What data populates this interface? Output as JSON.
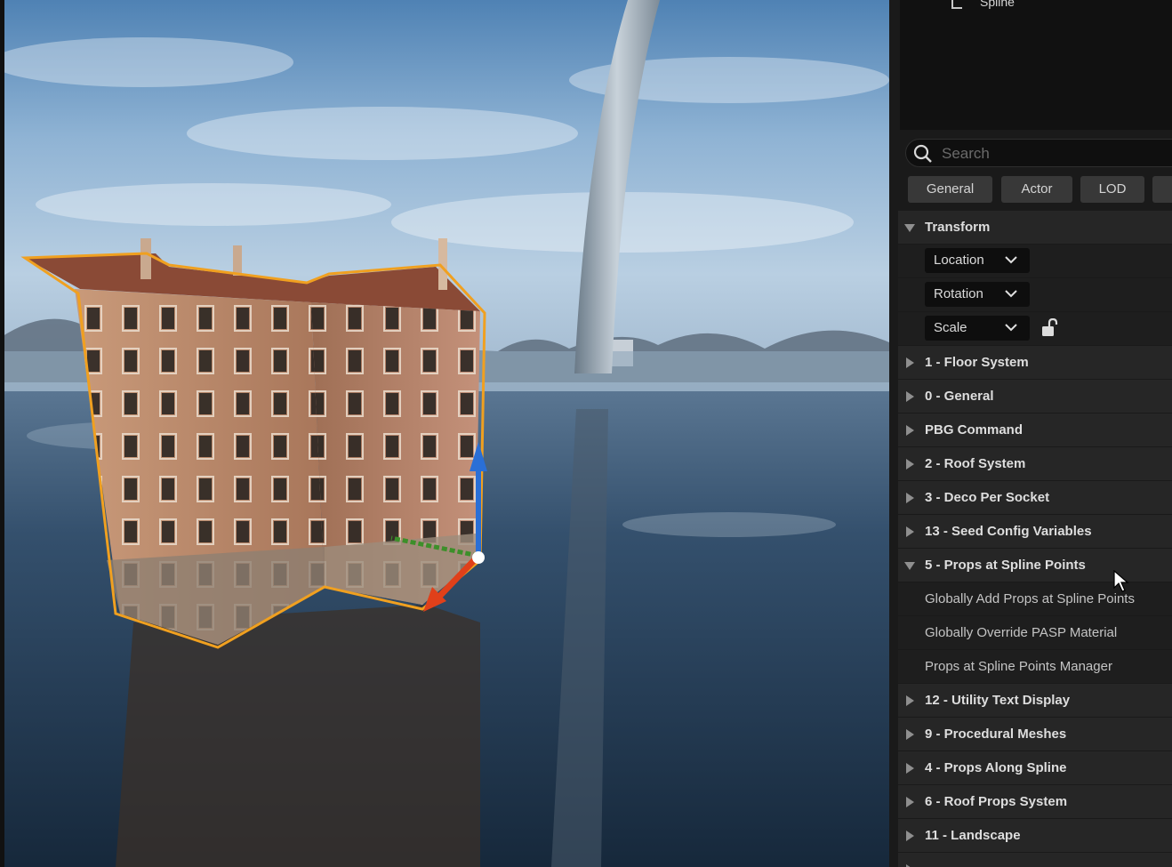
{
  "outliner": {
    "item_label": "Spline"
  },
  "search": {
    "placeholder": "Search"
  },
  "filter_tabs": [
    "General",
    "Actor",
    "LOD"
  ],
  "transform": {
    "header": "Transform",
    "dropdowns": [
      "Location",
      "Rotation",
      "Scale"
    ]
  },
  "categories": [
    "1 - Floor System",
    "0 - General",
    "PBG Command",
    "2 - Roof System",
    "3 - Deco Per Socket",
    "13 - Seed Config Variables",
    "5 - Props at Spline Points"
  ],
  "expanded_items": [
    "Globally Add Props at Spline Points",
    "Globally Override PASP Material",
    "Props at Spline Points Manager"
  ],
  "more_categories": [
    "12 - Utility Text Display",
    "9 - Procedural Meshes",
    "4 - Props Along Spline",
    "6 - Roof Props System",
    "11 - Landscape"
  ],
  "colors": {
    "selection_outline": "#f0a020",
    "gizmo_x": "#e0401a",
    "gizmo_y": "#3d8f2a",
    "gizmo_z": "#2a6fd6",
    "panel_bg": "#1a1a1a",
    "row_bg": "#262626"
  },
  "icons": [
    "search-icon",
    "chevron-down-icon",
    "unlock-icon",
    "caret-right-icon",
    "caret-down-icon",
    "mouse-cursor-icon",
    "spline-icon"
  ]
}
